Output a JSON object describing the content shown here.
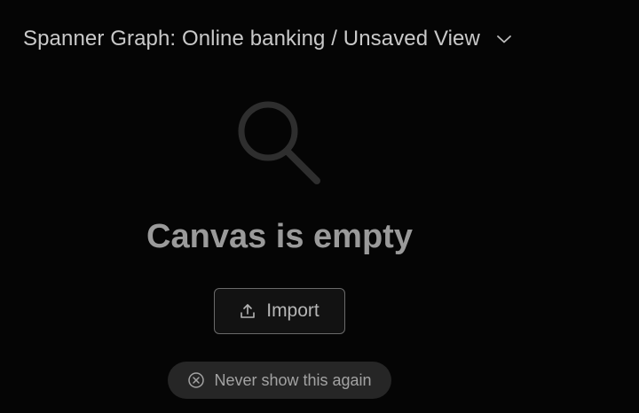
{
  "header": {
    "title": "Spanner Graph: Online banking / Unsaved View",
    "menu_icon": "chevron-down-icon"
  },
  "empty_state": {
    "icon": "search-icon",
    "title": "Canvas is empty",
    "import_button": {
      "label": "Import",
      "icon": "upload-icon"
    },
    "dismiss_chip": {
      "label": "Never show this again",
      "icon": "close-circle-icon"
    }
  },
  "colors": {
    "background": "#050505",
    "title_text": "#c9c9c9",
    "empty_title_text": "#9a9a9a",
    "icon_muted": "#2e2e2e",
    "chip_background": "#262626"
  }
}
